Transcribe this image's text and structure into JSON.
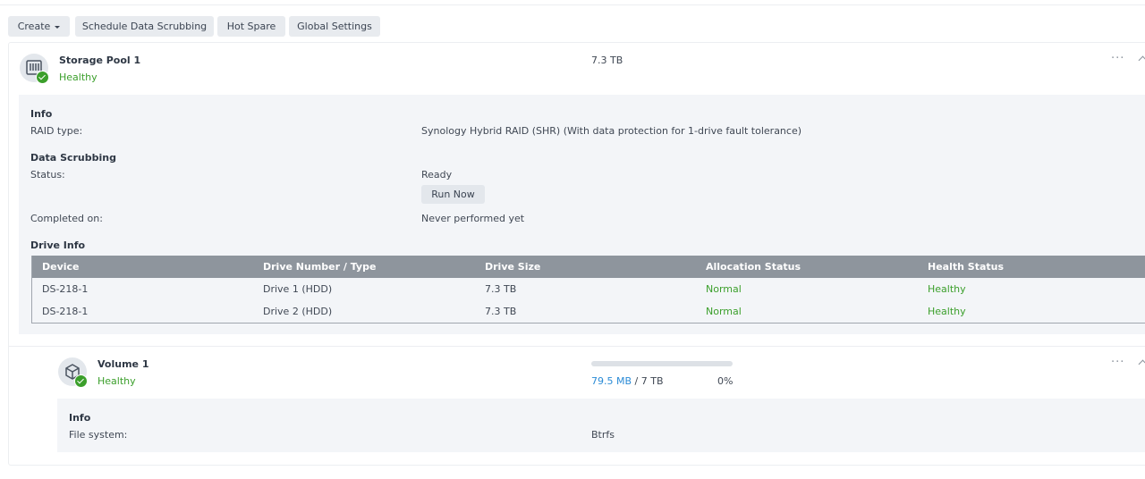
{
  "toolbar": {
    "create_label": "Create",
    "scrub_label": "Schedule Data Scrubbing",
    "hotspare_label": "Hot Spare",
    "global_label": "Global Settings"
  },
  "pool": {
    "name": "Storage Pool 1",
    "status": "Healthy",
    "capacity": "7.3 TB",
    "info_heading": "Info",
    "raid_label": "RAID type:",
    "raid_value": "Synology Hybrid RAID (SHR) (With data protection for 1-drive fault tolerance)",
    "scrub_heading": "Data Scrubbing",
    "status_label": "Status:",
    "status_value": "Ready",
    "run_now_label": "Run Now",
    "completed_label": "Completed on:",
    "completed_value": "Never performed yet",
    "drive_heading": "Drive Info"
  },
  "drives": {
    "columns": [
      "Device",
      "Drive Number / Type",
      "Drive Size",
      "Allocation Status",
      "Health Status"
    ],
    "rows": [
      [
        "DS-218-1",
        "Drive 1 (HDD)",
        "7.3 TB",
        "Normal",
        "Healthy"
      ],
      [
        "DS-218-1",
        "Drive 2 (HDD)",
        "7.3 TB",
        "Normal",
        "Healthy"
      ]
    ]
  },
  "volume": {
    "name": "Volume 1",
    "status": "Healthy",
    "used": "79.5 MB",
    "separator": "/",
    "total": "7 TB",
    "percent": "0%",
    "usage_fraction": 0.0,
    "info_heading": "Info",
    "fs_label": "File system:",
    "fs_value": "Btrfs"
  },
  "more_glyph": "···",
  "colors": {
    "healthy": "#3b9f2b",
    "header": "#8e959d",
    "link": "#2a8bd6"
  },
  "icons": {
    "pool": "nas-device-icon",
    "volume": "cube-icon",
    "check": "check-badge-icon"
  }
}
